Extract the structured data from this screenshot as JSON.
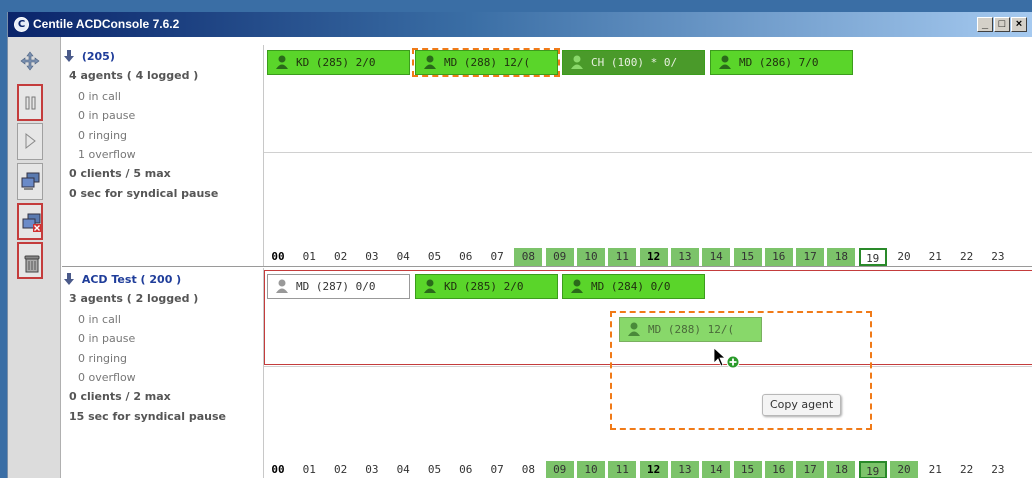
{
  "window": {
    "title": "Centile ACDConsole 7.6.2",
    "logo_letter": "C"
  },
  "title_buttons": {
    "minimize": "_",
    "restore": "□",
    "close": "×"
  },
  "toolbar": {
    "items": [
      {
        "name": "move-tool",
        "icon": "move-arrows-icon"
      },
      {
        "name": "pause-tool",
        "icon": "pause-icon"
      },
      {
        "name": "play-tool",
        "icon": "play-icon"
      },
      {
        "name": "computer-tool",
        "icon": "computer-icon"
      },
      {
        "name": "computer-remove-tool",
        "icon": "computer-remove-icon"
      },
      {
        "name": "trash-tool",
        "icon": "trash-icon"
      }
    ]
  },
  "queues": [
    {
      "header": "(205)",
      "agents_summary": "4 agents ( 4 logged )",
      "in_call": "0 in call",
      "in_pause": "0 in pause",
      "ringing": "0 ringing",
      "overflow": "1 overflow",
      "clients": "0 clients / 5 max",
      "syndical": "0 sec for syndical pause",
      "agents": [
        {
          "label": "KD (285)  2/0",
          "state": "green"
        },
        {
          "label": "MD (288)  12/(",
          "state": "green"
        },
        {
          "label": "CH (100) *  0/",
          "state": "dark"
        },
        {
          "label": "MD (286)  7/0",
          "state": "green"
        }
      ]
    },
    {
      "header": "ACD Test ( 200 )",
      "agents_summary": "3 agents ( 2 logged )",
      "in_call": "0 in call",
      "in_pause": "0 in pause",
      "ringing": "0 ringing",
      "overflow": "0 overflow",
      "clients": "0 clients / 2 max",
      "syndical": "15 sec for syndical pause",
      "agents": [
        {
          "label": "MD (287)  0/0",
          "state": "white"
        },
        {
          "label": "KD (285)  2/0",
          "state": "green"
        },
        {
          "label": "MD (284)  0/0",
          "state": "green"
        }
      ],
      "dragged_agent": "MD (288)  12/("
    }
  ],
  "hours": [
    "00",
    "01",
    "02",
    "03",
    "04",
    "05",
    "06",
    "07",
    "08",
    "09",
    "10",
    "11",
    "12",
    "13",
    "14",
    "15",
    "16",
    "17",
    "18",
    "19",
    "20",
    "21",
    "22",
    "23"
  ],
  "timeline1_active": [
    "08",
    "09",
    "10",
    "11",
    "12",
    "13",
    "14",
    "15",
    "16",
    "17",
    "18"
  ],
  "timeline2_active": [
    "09",
    "10",
    "11",
    "12",
    "13",
    "14",
    "15",
    "16",
    "17",
    "18",
    "19",
    "20"
  ],
  "bold_hours": [
    "00",
    "12"
  ],
  "current_hour": "19",
  "copy_tooltip": "Copy agent",
  "colors": {
    "active_agent": "#5ad52a",
    "selection": "#f07a18",
    "queue_border": "#c43c3c"
  }
}
